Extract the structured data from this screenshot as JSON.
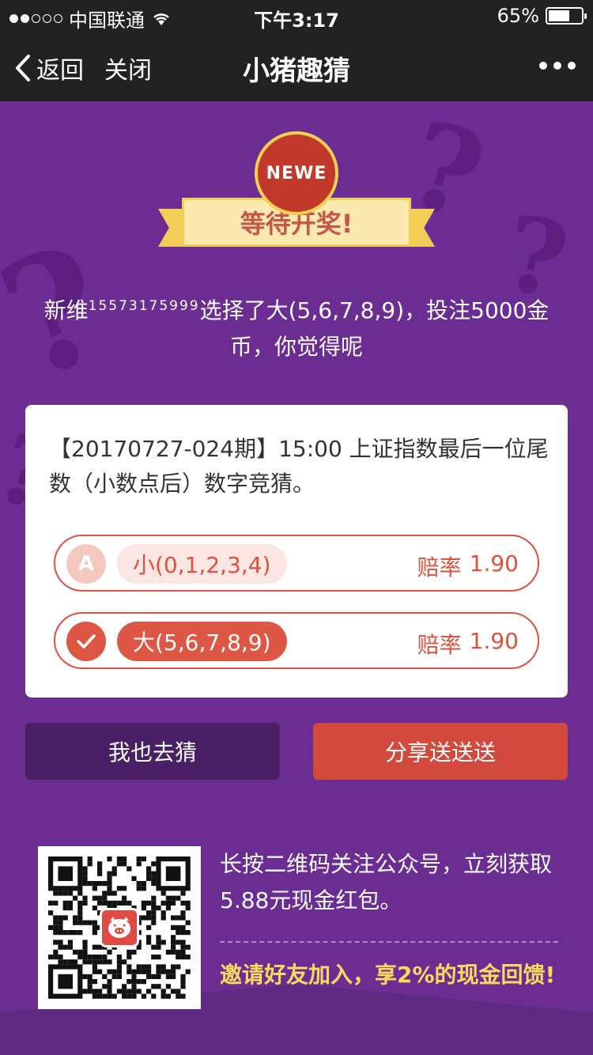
{
  "status_bar": {
    "carrier": "中国联通",
    "time": "下午3:17",
    "battery": "65%",
    "battery_level": 0.65
  },
  "nav": {
    "back_label": "返回",
    "close_label": "关闭",
    "title": "小猪趣猜"
  },
  "badge": {
    "logo_text": "NEWE",
    "ribbon_text": "等待开奖!"
  },
  "description": {
    "prefix": "新维",
    "user_id": "15573175999",
    "suffix": "选择了大(5,6,7,8,9)，投注5000金币，你觉得呢"
  },
  "card": {
    "question": "【20170727-024期】15:00 上证指数最后一位尾数（小数点后）数字竞猜。",
    "options": [
      {
        "marker": "A",
        "label": "小(0,1,2,3,4)",
        "odds_label": "赔率",
        "odds": "1.90",
        "selected": false
      },
      {
        "marker": "✓",
        "label": "大(5,6,7,8,9)",
        "odds_label": "赔率",
        "odds": "1.90",
        "selected": true
      }
    ]
  },
  "buttons": {
    "guess": "我也去猜",
    "share": "分享送送送"
  },
  "qr_section": {
    "follow_text": "长按二维码关注公众号，立刻获取5.88元现金红包。",
    "invite_text": "邀请好友加入，享2%的现金回馈!"
  },
  "colors": {
    "background": "#6b2d92",
    "accent_red": "#d9533f",
    "gold": "#f4cd55",
    "invite_yellow": "#f6dc5e"
  }
}
